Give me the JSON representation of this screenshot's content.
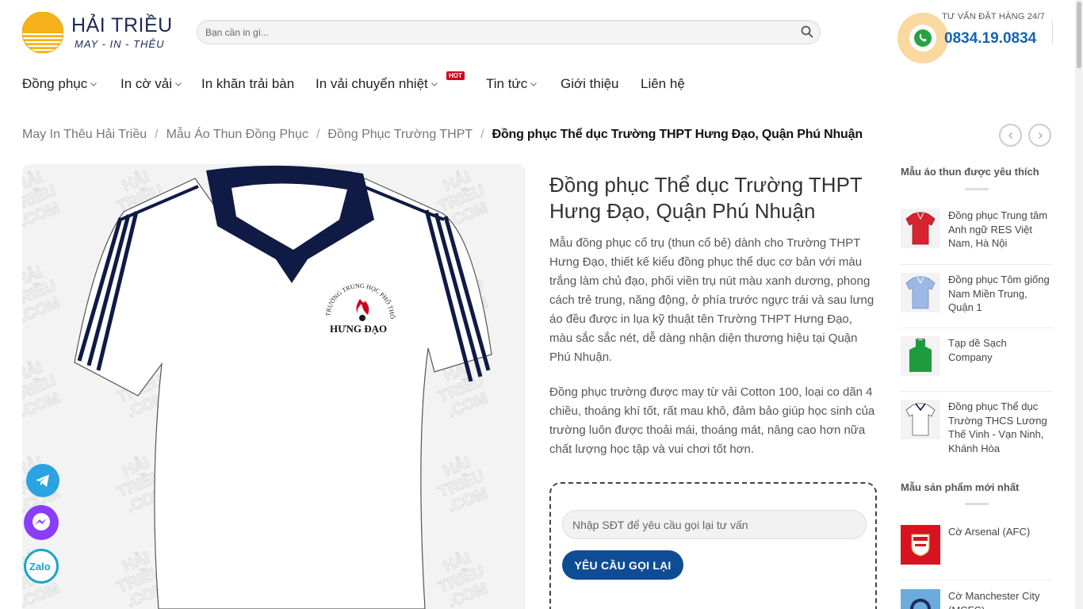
{
  "logo": {
    "title": "HẢI TRIỀU",
    "subtitle": "MAY - IN - THÊU"
  },
  "search": {
    "placeholder": "Bạn cần in gì..."
  },
  "hotline": {
    "label": "TƯ VẤN ĐẶT HÀNG 24/7",
    "number": "0834.19.0834"
  },
  "nav": [
    {
      "label": "Đồng phục",
      "dropdown": true
    },
    {
      "label": "In cờ vải",
      "dropdown": true
    },
    {
      "label": "In khăn trải bàn",
      "dropdown": false
    },
    {
      "label": "In vải chuyển nhiệt",
      "dropdown": true,
      "badge": "HOT"
    },
    {
      "label": "Tin tức",
      "dropdown": true
    },
    {
      "label": "Giới thiệu",
      "dropdown": false
    },
    {
      "label": "Liên hệ",
      "dropdown": false
    }
  ],
  "breadcrumb": {
    "items": [
      "May In Thêu Hải Triều",
      "Mẫu Áo Thun Đồng Phục",
      "Đồng Phục Trường THPT"
    ],
    "separator": "/",
    "current": "Đồng phục Thể dục Trường THPT Hưng Đạo, Quận Phú Nhuận"
  },
  "product": {
    "image_watermark": [
      "HẢI",
      "TRIỀU",
      ".COM"
    ],
    "shirt_logo_arc": "TRƯỜNG TRUNG HỌC PHỔ THÔNG",
    "shirt_logo_name": "HƯNG ĐẠO",
    "title": "Đồng phục Thể dục Trường THPT Hưng Đạo, Quận Phú Nhuận",
    "desc_1": "Mẫu đồng phục cổ trụ (thun cổ bẻ) dành cho Trường THPT Hưng Đạo, thiết kế kiểu đồng phục thể dục cơ bản với màu trắng làm chủ đạo, phối viền trụ nút màu xanh dương, phong cách trẻ trung, năng động, ở phía trước ngực trái và sau lưng áo đều được in lụa kỹ thuật tên Trường THPT Hưng Đạo, màu sắc sắc nét, dễ dàng nhận diện thương hiệu tại Quận Phú Nhuận.",
    "desc_2": "Đồng phục trường được may từ vải Cotton 100, loại co dãn 4 chiều, thoáng khí tốt, rất mau khô, đảm bảo giúp học sinh của trường luôn được thoải mái, thoáng mát, nâng cao hơn nữa chất lượng học tập và vui chơi tốt hơn."
  },
  "callback": {
    "placeholder": "Nhập SĐT để yêu cầu gọi lại tư vấn",
    "button": "YÊU CẦU GỌI LẠI"
  },
  "sidebar": {
    "favorites_heading": "Mẫu áo thun được yêu thích",
    "favorites": [
      {
        "title": "Đồng phục Trung tâm Anh ngữ RES Việt Nam, Hà Nội",
        "color": "#d62430"
      },
      {
        "title": "Đồng phục Tôm giống Nam Miền Trung, Quận 1",
        "color": "#9db8e6"
      },
      {
        "title": "Tạp dề Sạch Company",
        "color": "#1e9b3c"
      },
      {
        "title": "Đồng phục Thể dục Trường THCS Lương Thế Vinh - Vạn Ninh, Khánh Hòa",
        "color": "#ffffff"
      }
    ],
    "newest_heading": "Mẫu sản phẩm mới nhất",
    "newest": [
      {
        "title": "Cờ Arsenal (AFC)",
        "color": "#d9121f"
      },
      {
        "title": "Cờ Manchester City (MCFC)",
        "color": "#6cabdd"
      }
    ]
  },
  "social": [
    "telegram-icon",
    "messenger-icon",
    "zalo-icon"
  ],
  "social_labels": {
    "zalo": "Zalo"
  },
  "colors": {
    "accent": "#0e4d95",
    "hotline": "#1663b3",
    "hot_badge": "#d0021b",
    "logo_sun": "#f5b21b"
  }
}
